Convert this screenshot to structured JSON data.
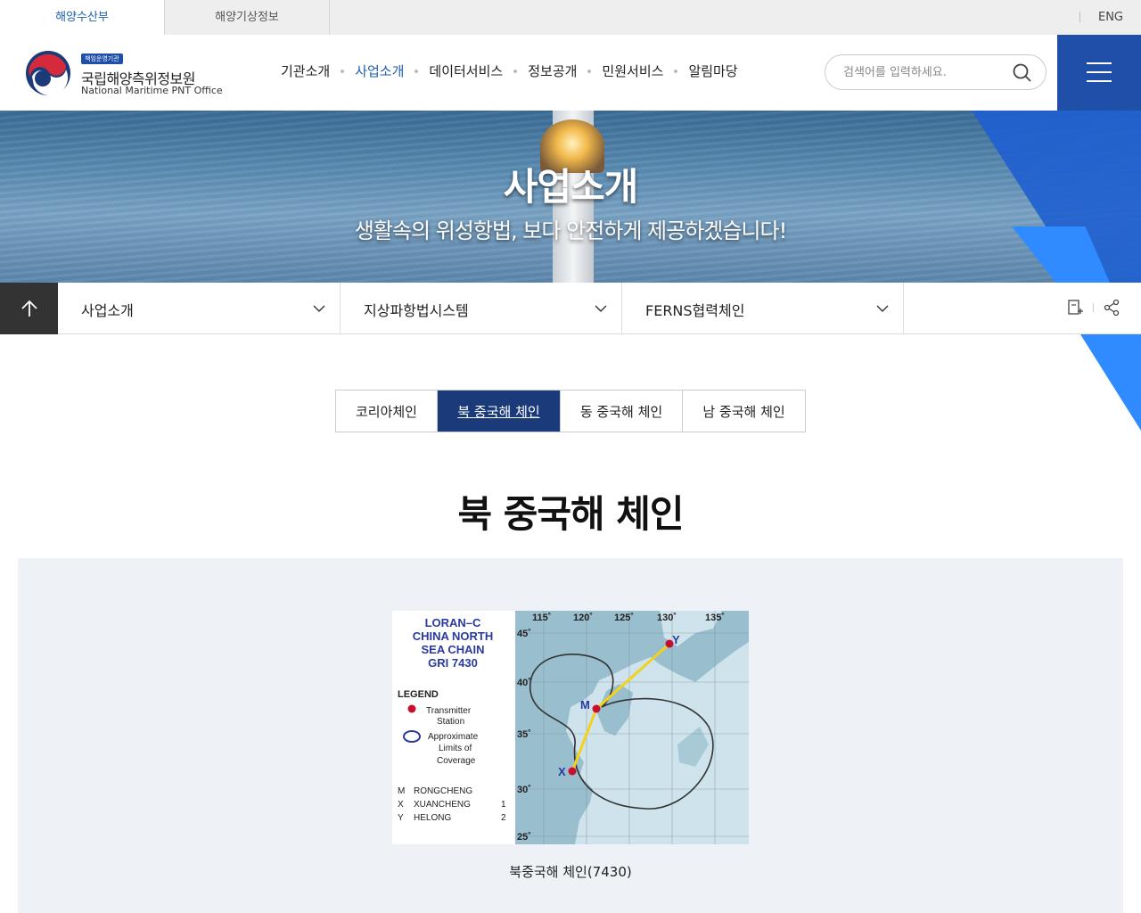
{
  "topbar": {
    "tabs": [
      {
        "label": "해양수산부"
      },
      {
        "label": "해양기상정보"
      }
    ],
    "lang": "ENG"
  },
  "header": {
    "badge": "책임운영기관",
    "org_name": "국립해양측위정보원",
    "org_name_en": "National Maritime PNT Office",
    "nav": [
      {
        "label": "기관소개"
      },
      {
        "label": "사업소개"
      },
      {
        "label": "데이터서비스"
      },
      {
        "label": "정보공개"
      },
      {
        "label": "민원서비스"
      },
      {
        "label": "알림마당"
      }
    ],
    "search_placeholder": "검색어를 입력하세요."
  },
  "hero": {
    "title": "사업소개",
    "subtitle": "생활속의 위성항법, 보다 안전하게 제공하겠습니다!"
  },
  "location": {
    "items": [
      {
        "label": "사업소개"
      },
      {
        "label": "지상파항법시스템"
      },
      {
        "label": "FERNS협력체인"
      }
    ]
  },
  "tabs": [
    {
      "label": "코리아체인"
    },
    {
      "label": "북 중국해 체인"
    },
    {
      "label": "동 중국해 체인"
    },
    {
      "label": "남 중국해 체인"
    }
  ],
  "page_title": "북 중국해 체인",
  "map": {
    "title_lines": [
      "LORAN–C",
      "CHINA NORTH",
      "SEA CHAIN",
      "GRI 7430"
    ],
    "legend_title": "LEGEND",
    "legend_transmitter": [
      "Transmitter",
      "Station"
    ],
    "legend_coverage": [
      "Approximate",
      "Limits of",
      "Coverage"
    ],
    "stations": [
      {
        "code": "M",
        "name": "RONGCHENG",
        "num": ""
      },
      {
        "code": "X",
        "name": "XUANCHENG",
        "num": "1"
      },
      {
        "code": "Y",
        "name": "HELONG",
        "num": "2"
      }
    ],
    "lon_labels": [
      "115˚",
      "120˚",
      "125˚",
      "130˚",
      "135˚"
    ],
    "lat_labels": [
      "45˚",
      "40˚",
      "35˚",
      "30˚",
      "25˚"
    ]
  },
  "caption": "북중국해 체인(7430)"
}
